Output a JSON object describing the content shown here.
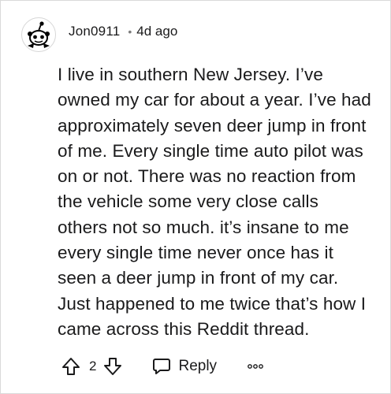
{
  "comment": {
    "username": "Jon0911",
    "separator": "•",
    "timestamp": "4d ago",
    "avatar_icon": "snoo-avatar-icon",
    "body": "I live in southern New Jersey. I’ve owned my car for about a year. I’ve had approximately seven deer jump in front of me. Every single time auto pilot was on or not. There was no reaction from the vehicle some very close calls others not so much. it’s insane to me every single time never once has it seen a deer jump in front of my car. Just happened to me twice that’s how I came across this Reddit thread."
  },
  "actions": {
    "upvote_icon": "upvote-arrow-icon",
    "vote_count": "2",
    "downvote_icon": "downvote-arrow-icon",
    "reply_icon": "chat-bubble-icon",
    "reply_label": "Reply",
    "more_icon": "more-options-icon"
  }
}
